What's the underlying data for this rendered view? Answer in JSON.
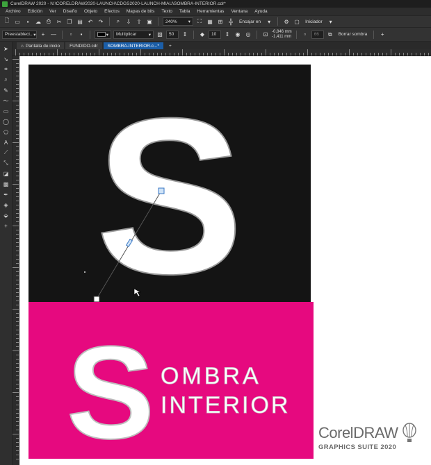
{
  "window": {
    "title": "CorelDRAW 2020 - N:\\CORELDRAW2020-LAUNCH\\CDGS2020-LAUNCH-MIAU\\SOMBRA-INTERIOR.cdr*"
  },
  "menu": [
    "Archivo",
    "Edición",
    "Ver",
    "Diseño",
    "Objeto",
    "Efectos",
    "Mapas de bits",
    "Texto",
    "Tabla",
    "Herramientas",
    "Ventana",
    "Ayuda"
  ],
  "toolbar": {
    "zoom": "240%",
    "snap_label": "Encajar en",
    "launch_label": "Iniciador"
  },
  "property_bar": {
    "preset": "Preestableci...",
    "blend_mode": "Multiplicar",
    "opacity": "50",
    "feather": "10",
    "offset_x": "-0,846 mm",
    "offset_y": "-1,411 mm",
    "value_66": "66",
    "clear_shadow": "Borrar sombra"
  },
  "tabs": [
    {
      "label": "Pantalla de inicio",
      "active": false
    },
    {
      "label": "FUNDIDO.cdr",
      "active": false
    },
    {
      "label": "SOMBRA-INTERIOR.c...*",
      "active": true
    }
  ],
  "artwork": {
    "big_letter": "S",
    "line1": "OMBRA",
    "line2": "INTERIOR",
    "dark_bg": "#141414",
    "pink_bg": "#e6097f"
  },
  "brand": {
    "name": "CorelDRAW",
    "sub": "GRAPHICS SUITE 2020"
  }
}
